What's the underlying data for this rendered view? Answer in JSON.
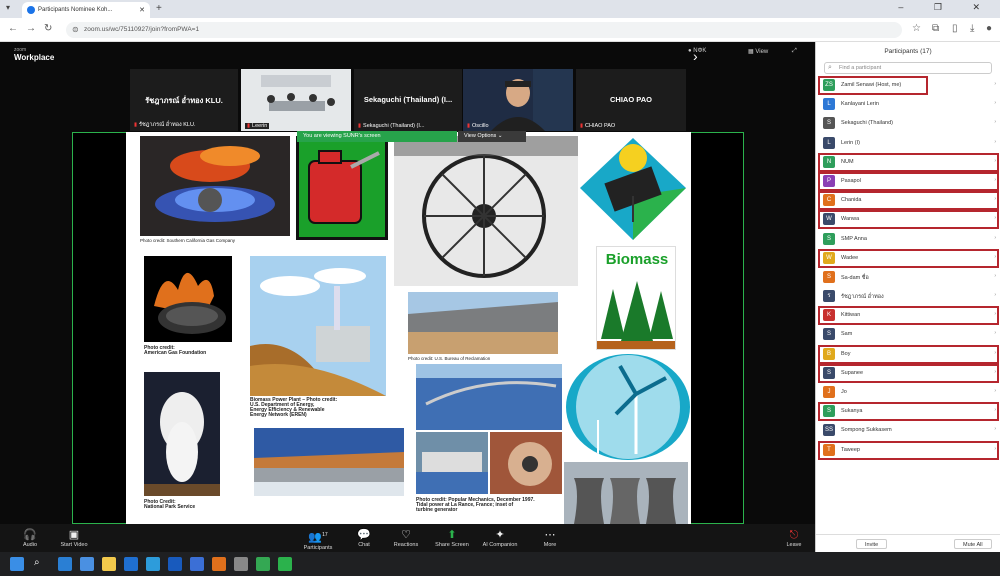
{
  "browser": {
    "tab_title": "Participants Nominee Koh...",
    "url": "zoom.us/wc/75110927/join?fromPWA=1",
    "new_tab": "+",
    "window_controls": "– ❐ ✕"
  },
  "zoom": {
    "brand_line1": "zoom",
    "brand_line2": "Workplace",
    "top_right_status": "● ΝΦΚ",
    "top_right_view": "▦ View",
    "tiles": [
      {
        "name": "รัชฎาภรณ์ อ่ำทอง KLU.",
        "label": "รัชฎาภรณ์ อ่ำทอง KLU."
      },
      {
        "name": "",
        "label": "Leerin"
      },
      {
        "name": "Sekaguchi (Thailand) (I...",
        "label": "Sekaguchi (Thailand) (I..."
      },
      {
        "name": "",
        "label": "Oscillo"
      },
      {
        "name": "CHIAO PAO",
        "label": "CHIAO PAO"
      }
    ],
    "share_banner": "You are viewing SUNR's screen",
    "view_options": "View Options ⌄",
    "slide": {
      "cap1": "Photo credit: Southern California Gas Company",
      "cap2a": "Photo credit:",
      "cap2b": "American Gas Foundation",
      "cap3a": "Biomass Power Plant – Photo credit:",
      "cap3b": "U.S. Department of Energy,",
      "cap3c": "Energy Efficiency & Renewable",
      "cap3d": "Energy Network (EREN)",
      "cap4a": "Photo Credit:",
      "cap4b": "National Park Service",
      "cap5": "Photo credit: U.S. Bureau of Reclamation",
      "cap6a": "Photo credit: Popular Mechanics, December 1997.",
      "cap6b": "Tidal power at La Rance, France; inset of",
      "cap6c": "turbine generator",
      "biomass": "Biomass"
    },
    "controls": {
      "audio": "Audio",
      "video": "Start Video",
      "participants": "Participants",
      "participants_count": "17",
      "chat": "Chat",
      "reactions": "Reactions",
      "share": "Share Screen",
      "companion": "AI Companion",
      "more": "More",
      "leave": "Leave"
    }
  },
  "panel": {
    "title": "Participants (17)",
    "search_placeholder": "Find a participant",
    "participants": [
      {
        "initial": "ZS",
        "name": "Zamil Senawi (Host, me)",
        "color": "#2e9e5b",
        "highlight": true
      },
      {
        "initial": "L",
        "name": "Kanlayani Lerin",
        "color": "#2d78d6",
        "highlight": false
      },
      {
        "initial": "S",
        "name": "Sekaguchi (Thailand)",
        "color": "#555555",
        "highlight": false
      },
      {
        "initial": "L",
        "name": "Lerin (I)",
        "color": "#3a4a6a",
        "highlight": false
      },
      {
        "initial": "N",
        "name": "NUM",
        "color": "#2e9e5b",
        "highlight": true
      },
      {
        "initial": "P",
        "name": "Pasapol",
        "color": "#8a3fb4",
        "highlight": true
      },
      {
        "initial": "C",
        "name": "Chanida",
        "color": "#e0701c",
        "highlight": true
      },
      {
        "initial": "W",
        "name": "Wanwa",
        "color": "#3a4a6a",
        "highlight": true
      },
      {
        "initial": "S",
        "name": "SMP Anna",
        "color": "#2e9e5b",
        "highlight": false
      },
      {
        "initial": "W",
        "name": "Wadee",
        "color": "#e0a91c",
        "highlight": true
      },
      {
        "initial": "S",
        "name": "Sa-dam ชื่อ",
        "color": "#e0701c",
        "highlight": false
      },
      {
        "initial": "ร",
        "name": "รัชฎาภรณ์ อ่ำทอง",
        "color": "#3a4a6a",
        "highlight": false
      },
      {
        "initial": "K",
        "name": "Kittiwan",
        "color": "#c8312f",
        "highlight": true
      },
      {
        "initial": "S",
        "name": "Sam",
        "color": "#3a4a6a",
        "highlight": false
      },
      {
        "initial": "B",
        "name": "Boy",
        "color": "#e0a91c",
        "highlight": true
      },
      {
        "initial": "S",
        "name": "Supanee",
        "color": "#3a4a6a",
        "highlight": true
      },
      {
        "initial": "J",
        "name": "Jo",
        "color": "#e0701c",
        "highlight": false
      },
      {
        "initial": "S",
        "name": "Sukanya",
        "color": "#2e9e5b",
        "highlight": true
      },
      {
        "initial": "SS",
        "name": "Sompong Sukkasem",
        "color": "#3a4a6a",
        "highlight": false
      },
      {
        "initial": "T",
        "name": "Taweep",
        "color": "#e0701c",
        "highlight": true
      }
    ],
    "invite": "Invite",
    "mute_all": "Mute All"
  }
}
